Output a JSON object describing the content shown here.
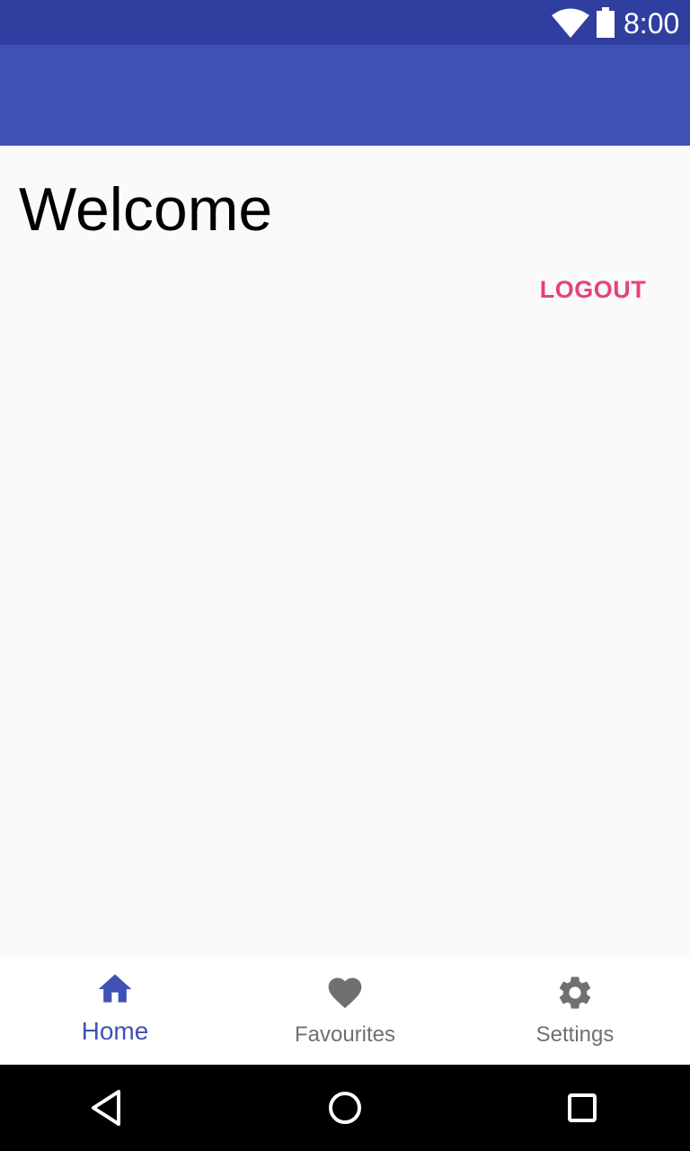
{
  "status_bar": {
    "time": "8:00",
    "icons": [
      "wifi-icon",
      "battery-icon"
    ]
  },
  "main": {
    "title": "Welcome",
    "logout_label": "LOGOUT"
  },
  "bottom_nav": {
    "items": [
      {
        "label": "Home",
        "icon": "home-icon",
        "active": true
      },
      {
        "label": "Favourites",
        "icon": "heart-icon",
        "active": false
      },
      {
        "label": "Settings",
        "icon": "gear-icon",
        "active": false
      }
    ]
  },
  "system_nav": {
    "buttons": [
      "back-icon",
      "home-circle-icon",
      "recents-icon"
    ]
  },
  "colors": {
    "status_bar": "#303f9f",
    "app_bar": "#3f51b5",
    "accent": "#e8407e",
    "nav_active": "#3f51b5",
    "nav_inactive": "#707070",
    "background": "#fafafa"
  }
}
